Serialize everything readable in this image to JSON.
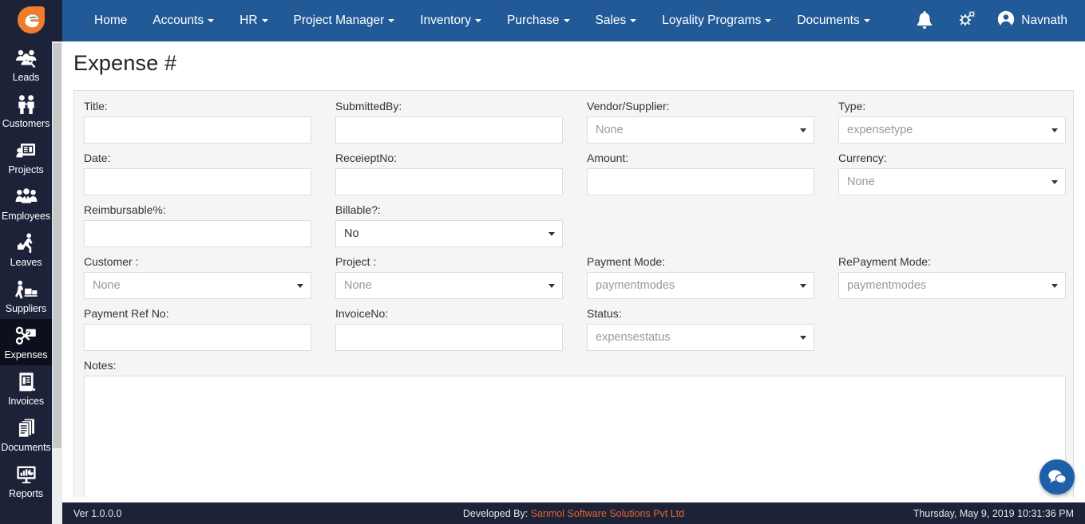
{
  "brand": {
    "logo_icon": "epro-logo-icon",
    "accent_blue": "#215a97",
    "sidebar_bg": "#1c2238",
    "accent_orange": "#e8622a"
  },
  "sidebar": {
    "items": [
      {
        "label": "Leads",
        "icon": "leads-icon",
        "active": false
      },
      {
        "label": "Customers",
        "icon": "customers-icon",
        "active": false
      },
      {
        "label": "Projects",
        "icon": "projects-icon",
        "active": false
      },
      {
        "label": "Employees",
        "icon": "employees-icon",
        "active": false
      },
      {
        "label": "Leaves",
        "icon": "leaves-icon",
        "active": false
      },
      {
        "label": "Suppliers",
        "icon": "suppliers-icon",
        "active": false
      },
      {
        "label": "Expenses",
        "icon": "expenses-icon",
        "active": true
      },
      {
        "label": "Invoices",
        "icon": "invoices-icon",
        "active": false
      },
      {
        "label": "Documents",
        "icon": "documents-icon",
        "active": false
      },
      {
        "label": "Reports",
        "icon": "reports-icon",
        "active": false
      }
    ]
  },
  "topnav": {
    "items": [
      {
        "label": "Home",
        "has_caret": false
      },
      {
        "label": "Accounts",
        "has_caret": true
      },
      {
        "label": "HR",
        "has_caret": true
      },
      {
        "label": "Project Manager",
        "has_caret": true
      },
      {
        "label": "Inventory",
        "has_caret": true
      },
      {
        "label": "Purchase",
        "has_caret": true
      },
      {
        "label": "Sales",
        "has_caret": true
      },
      {
        "label": "Loyality Programs",
        "has_caret": true
      },
      {
        "label": "Documents",
        "has_caret": true
      }
    ],
    "notification_icon": "bell-icon",
    "settings_icon": "gears-icon",
    "user_icon": "user-avatar-icon",
    "user_name": "Navnath"
  },
  "page": {
    "title": "Expense #"
  },
  "form": {
    "title": {
      "label": "Title:",
      "value": "",
      "type": "text"
    },
    "submitted_by": {
      "label": "SubmittedBy:",
      "value": "",
      "type": "text"
    },
    "vendor": {
      "label": "Vendor/Supplier:",
      "value": "None",
      "type": "select"
    },
    "type": {
      "label": "Type:",
      "value": "expensetype",
      "type": "select"
    },
    "date": {
      "label": "Date:",
      "value": "",
      "type": "text"
    },
    "receipt_no": {
      "label": "ReceieptNo:",
      "value": "",
      "type": "text"
    },
    "amount": {
      "label": "Amount:",
      "value": "",
      "type": "text"
    },
    "currency": {
      "label": "Currency:",
      "value": "None",
      "type": "select"
    },
    "reimbursable": {
      "label": "Reimbursable%:",
      "value": "",
      "type": "text"
    },
    "billable": {
      "label": "Billable?:",
      "value": "No",
      "type": "select",
      "selected_dark": true
    },
    "customer": {
      "label": "Customer :",
      "value": "None",
      "type": "select"
    },
    "project": {
      "label": "Project :",
      "value": "None",
      "type": "select"
    },
    "payment_mode": {
      "label": "Payment Mode:",
      "value": "paymentmodes",
      "type": "select"
    },
    "repayment_mode": {
      "label": "RePayment Mode:",
      "value": "paymentmodes",
      "type": "select"
    },
    "payment_ref": {
      "label": "Payment Ref No:",
      "value": "",
      "type": "text"
    },
    "invoice_no": {
      "label": "InvoiceNo:",
      "value": "",
      "type": "text"
    },
    "status": {
      "label": "Status:",
      "value": "expensestatus",
      "type": "select"
    },
    "notes": {
      "label": "Notes:",
      "value": "",
      "type": "textarea"
    }
  },
  "chat": {
    "icon": "chat-bubble-icon"
  },
  "footer": {
    "version": "Ver 1.0.0.0",
    "developed_by_prefix": "Developed By: ",
    "developed_by_link": "Sanmol Software Solutions Pvt Ltd",
    "datetime": "Thursday, May 9, 2019 10:31:36 PM"
  }
}
